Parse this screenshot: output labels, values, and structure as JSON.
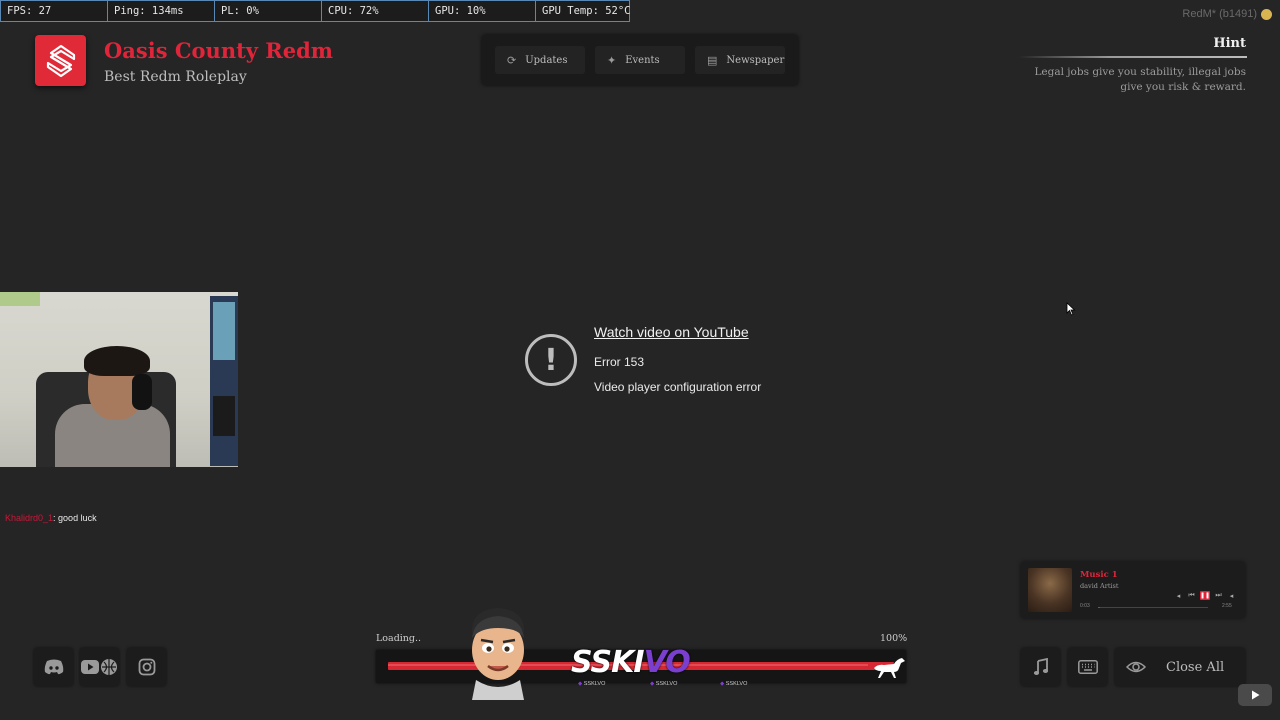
{
  "stats": [
    "FPS: 27",
    "Ping: 134ms",
    "PL: 0%",
    "CPU: 72%",
    "GPU: 10%",
    "GPU Temp: 52°C"
  ],
  "build_tag": "RedM* (b1491)",
  "brand": {
    "title": "Oasis County Redm",
    "subtitle": "Best Redm Roleplay",
    "accent": "#e0253a"
  },
  "nav": [
    {
      "label": "Updates",
      "icon": "refresh-icon"
    },
    {
      "label": "Events",
      "icon": "sparkle-icon"
    },
    {
      "label": "Newspaper",
      "icon": "newspaper-icon"
    }
  ],
  "hint": {
    "title": "Hint",
    "text": "Legal jobs give you stability, illegal jobs give you risk & reward."
  },
  "chat": {
    "user": "Khalidrd0_1",
    "message": ": good luck"
  },
  "video_error": {
    "link": "Watch video on YouTube",
    "code": "Error 153",
    "message": "Video player configuration error"
  },
  "music": {
    "title": "Music 1",
    "artist": "david Artist",
    "current_time": "0:03",
    "total_time": "2:55",
    "progress": 0.02
  },
  "social": [
    {
      "name": "discord-button",
      "icon": "discord-icon"
    },
    {
      "name": "youtube-web-button",
      "icon": "youtube-globe-icon"
    },
    {
      "name": "instagram-button",
      "icon": "instagram-icon"
    }
  ],
  "loading": {
    "label": "Loading..",
    "percent_text": "100%",
    "progress": 1.0,
    "wordmark_main": "SSKI",
    "wordmark_accent": "VO",
    "sub_tags": [
      "SSKLVO",
      "SSKLVO",
      "SSKLVO"
    ]
  },
  "controls": {
    "close_all": "Close All"
  },
  "colors": {
    "background": "#252525",
    "panel": "#1c1c1c",
    "accent_red": "#e0253a",
    "accent_purple": "#7b3fcf",
    "stats_border": "#5a88b5"
  }
}
